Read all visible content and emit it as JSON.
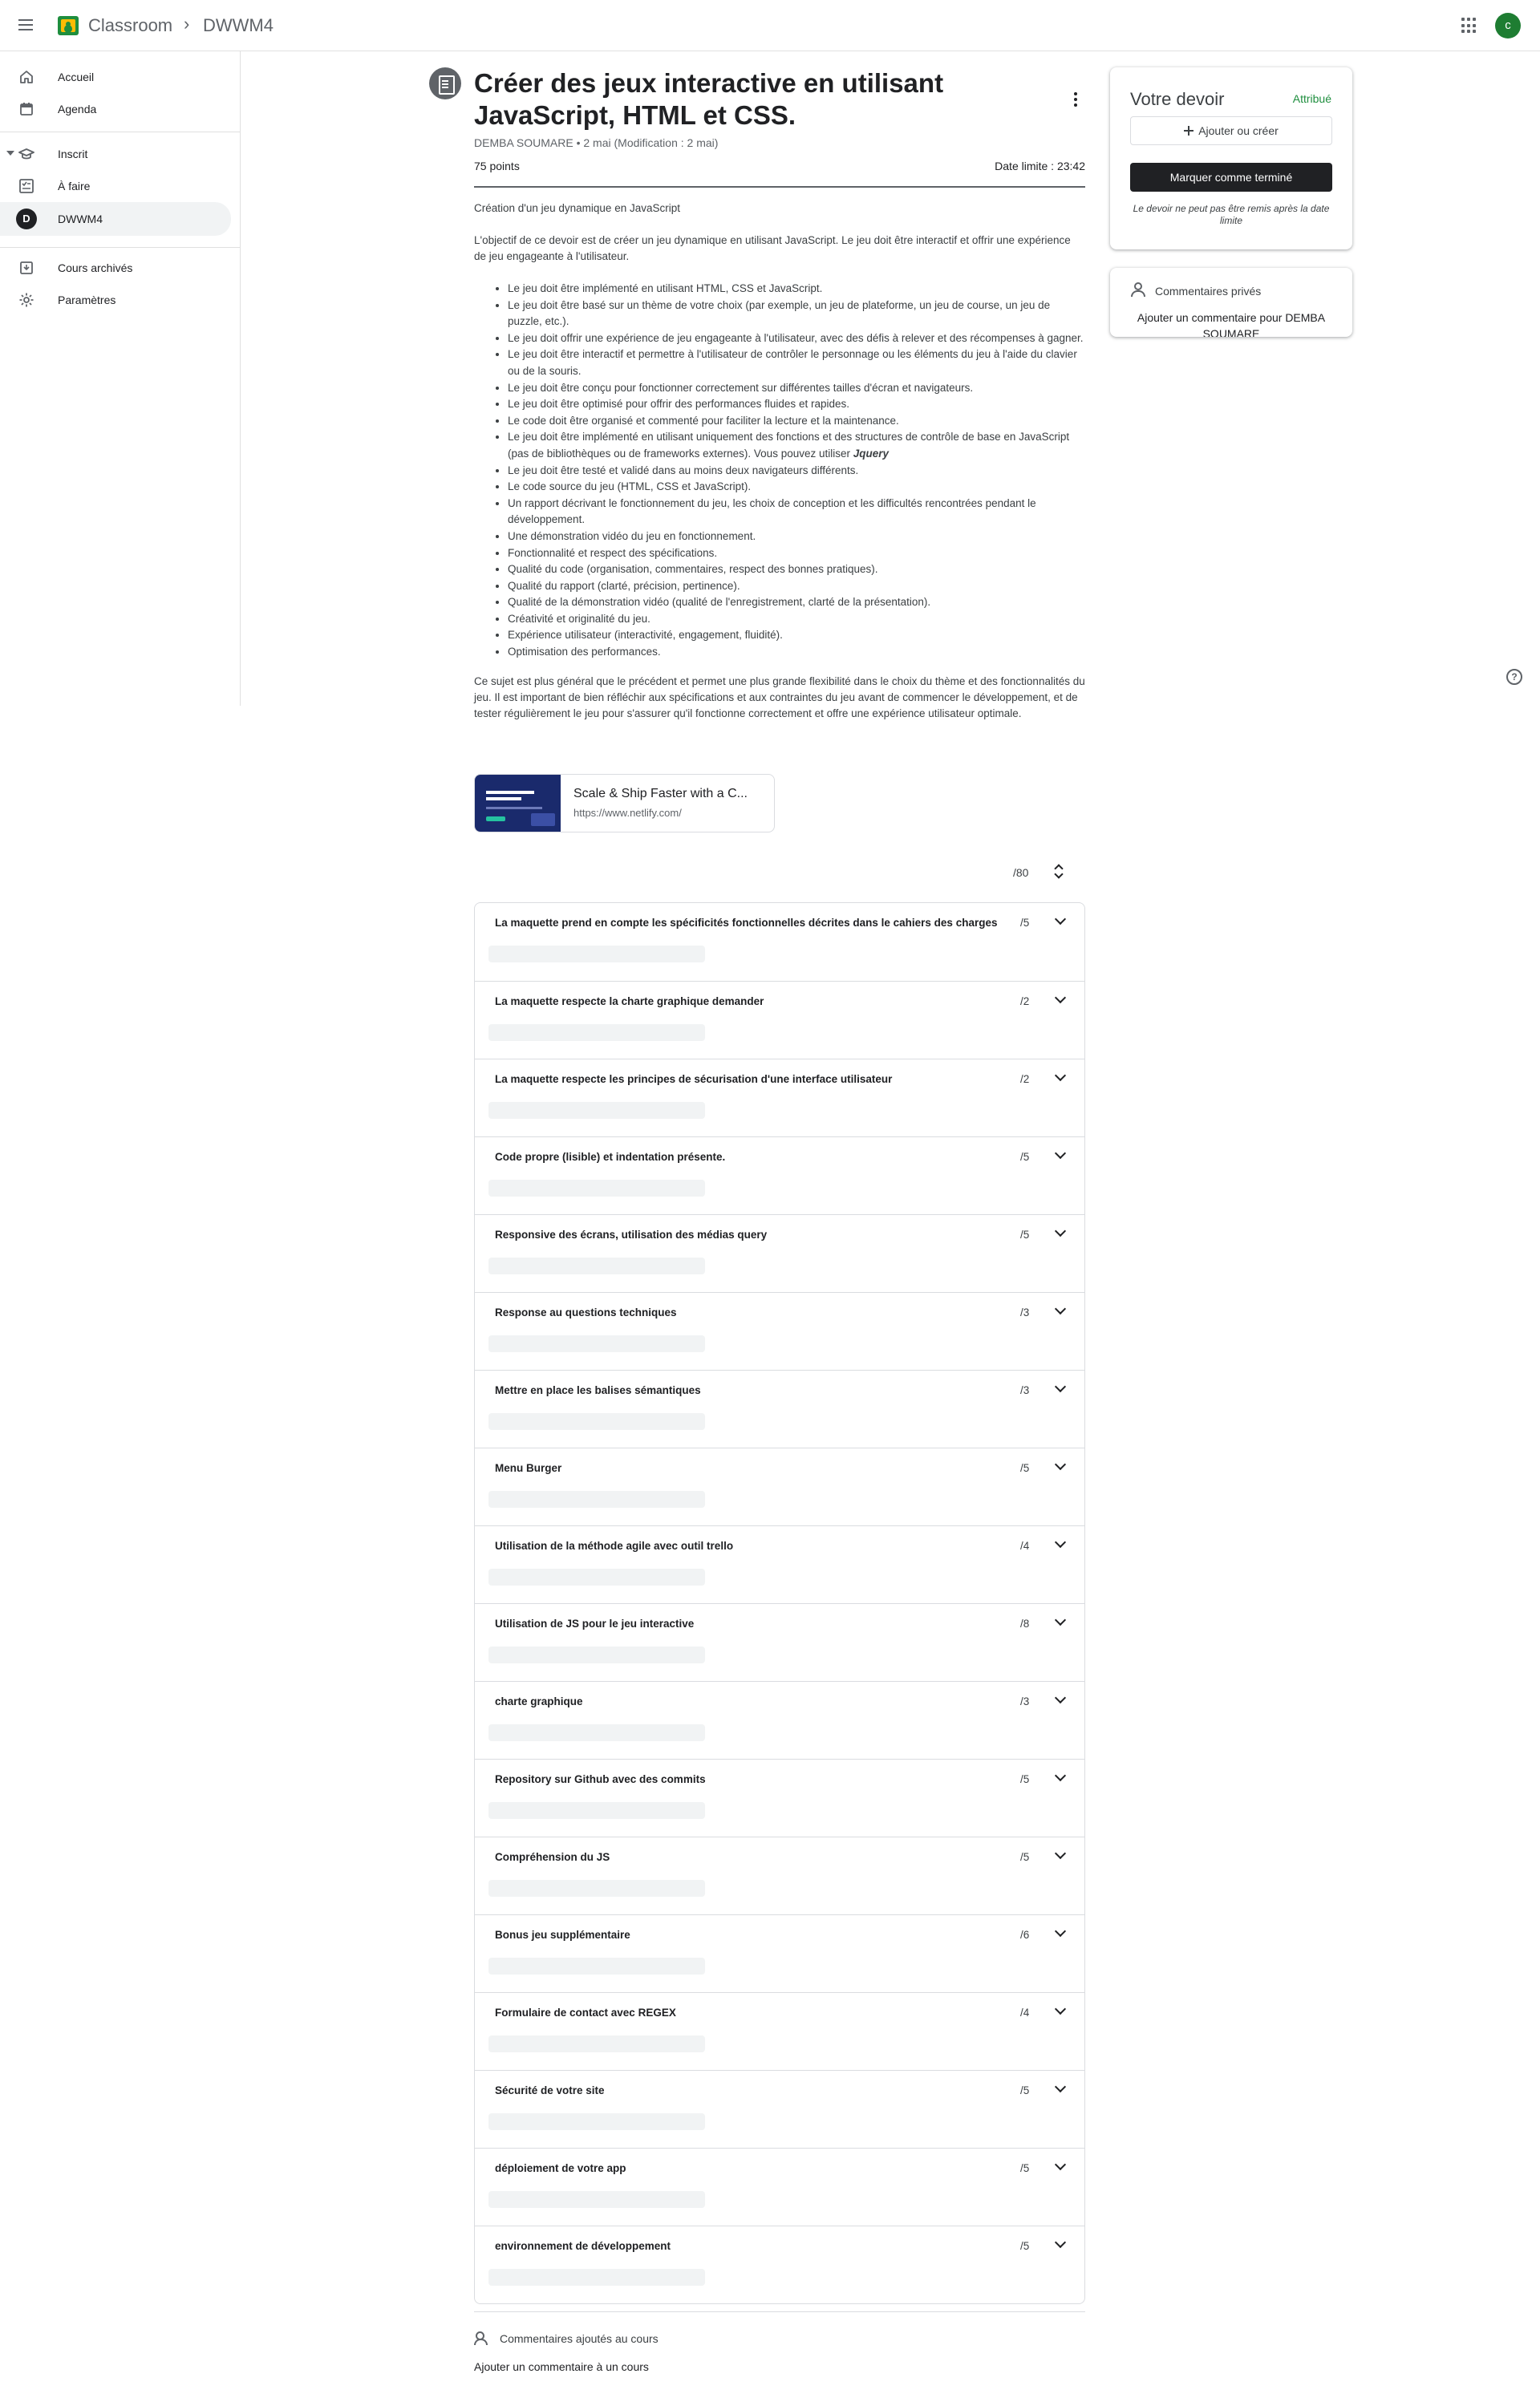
{
  "topbar": {
    "brand": "Classroom",
    "separator": "›",
    "breadcrumb": "DWWM4",
    "account_initial": "c"
  },
  "sidebar": {
    "items": [
      {
        "label": "Accueil",
        "icon": "home-icon"
      },
      {
        "label": "Agenda",
        "icon": "calendar-icon"
      },
      {
        "label": "Inscrit",
        "icon": "graduation-cap-icon"
      },
      {
        "label": "À faire",
        "icon": "todo-list-icon"
      },
      {
        "label": "DWWM4",
        "icon": "class-avatar",
        "initial": "D"
      },
      {
        "label": "Cours archivés",
        "icon": "archive-icon"
      },
      {
        "label": "Paramètres",
        "icon": "gear-icon"
      }
    ]
  },
  "assignment": {
    "title": "Créer des jeux interactive en utilisant JavaScript, HTML et CSS.",
    "meta": "DEMBA SOUMARE • 2 mai (Modification : 2 mai)",
    "points": "75 points",
    "deadline": "Date limite : 23:42",
    "intro": "Création d'un jeu dynamique en JavaScript",
    "objective": "L'objectif de ce devoir est de créer un jeu dynamique en utilisant JavaScript. Le jeu doit être interactif et offrir une expérience de jeu engageante à l'utilisateur.",
    "requirements": [
      "Le jeu doit être implémenté en utilisant HTML, CSS et JavaScript.",
      "Le jeu doit être basé sur un thème de votre choix (par exemple, un jeu de plateforme, un jeu de course, un jeu de puzzle, etc.).",
      "Le jeu doit offrir une expérience de jeu engageante à l'utilisateur, avec des défis à relever et des récompenses à gagner.",
      "Le jeu doit être interactif et permettre à l'utilisateur de contrôler le personnage ou les éléments du jeu à l'aide du clavier ou de la souris.",
      "Le jeu doit être conçu pour fonctionner correctement sur différentes tailles d'écran et navigateurs.",
      "Le jeu doit être optimisé pour offrir des performances fluides et rapides.",
      "Le code doit être organisé et commenté pour faciliter la lecture et la maintenance."
    ],
    "requirement_jquery_prefix": "Le jeu doit être implémenté en utilisant uniquement des fonctions et des structures de contrôle de base en JavaScript (pas de bibliothèques ou de frameworks externes). Vous pouvez utiliser ",
    "requirement_jquery_emphasis": "Jquery",
    "requirements_after": [
      "Le jeu doit être testé et validé dans au moins deux navigateurs différents.",
      "Le code source du jeu (HTML, CSS et JavaScript).",
      "Un rapport décrivant le fonctionnement du jeu, les choix de conception et les difficultés rencontrées pendant le développement.",
      "Une démonstration vidéo du jeu en fonctionnement.",
      "Fonctionnalité et respect des spécifications.",
      "Qualité du code (organisation, commentaires, respect des bonnes pratiques).",
      "Qualité du rapport (clarté, précision, pertinence).",
      "Qualité de la démonstration vidéo (qualité de l'enregistrement, clarté de la présentation).",
      "Créativité et originalité du jeu.",
      "Expérience utilisateur (interactivité, engagement, fluidité).",
      "Optimisation des performances."
    ],
    "conclusion": "Ce sujet est plus général que le précédent et permet une plus grande flexibilité dans le choix du thème et des fonctionnalités du jeu. Il est important de bien réfléchir aux spécifications et aux contraintes du jeu avant de commencer le développement, et de tester régulièrement le jeu pour s'assurer qu'il fonctionne correctement et offre une expérience utilisateur optimale.",
    "attachment": {
      "title": "Scale & Ship Faster with a C...",
      "url": "https://www.netlify.com/"
    }
  },
  "rubric": {
    "total": "/80",
    "criteria": [
      {
        "label": "La maquette prend en compte les spécificités fonctionnelles décrites dans le cahiers des charges",
        "score": "/5"
      },
      {
        "label": "La maquette respecte la charte graphique demander",
        "score": "/2"
      },
      {
        "label": "La maquette respecte les principes de sécurisation d'une interface utilisateur",
        "score": "/2"
      },
      {
        "label": "Code propre (lisible) et indentation présente.",
        "score": "/5"
      },
      {
        "label": "Responsive des écrans, utilisation des médias query",
        "score": "/5"
      },
      {
        "label": "Response au questions techniques",
        "score": "/3"
      },
      {
        "label": "Mettre en place les balises sémantiques",
        "score": "/3"
      },
      {
        "label": "Menu Burger",
        "score": "/5"
      },
      {
        "label": "Utilisation de la méthode agile avec outil trello",
        "score": "/4"
      },
      {
        "label": "Utilisation de JS pour le jeu interactive",
        "score": "/8"
      },
      {
        "label": "charte graphique",
        "score": "/3"
      },
      {
        "label": "Repository sur Github avec des commits",
        "score": "/5"
      },
      {
        "label": "Compréhension du JS",
        "score": "/5"
      },
      {
        "label": "Bonus jeu supplémentaire",
        "score": "/6"
      },
      {
        "label": "Formulaire de contact avec REGEX",
        "score": "/4"
      },
      {
        "label": "Sécurité de votre site",
        "score": "/5"
      },
      {
        "label": "déploiement de votre app",
        "score": "/5"
      },
      {
        "label": "environnement de développement",
        "score": "/5"
      }
    ]
  },
  "class_comments": {
    "title": "Commentaires ajoutés au cours",
    "add_label": "Ajouter un commentaire à un cours"
  },
  "your_work": {
    "title": "Votre devoir",
    "status": "Attribué",
    "add_label": "Ajouter ou créer",
    "done_label": "Marquer comme terminé",
    "late_note": "Le devoir ne peut pas être remis après la date limite"
  },
  "private_comments": {
    "title": "Commentaires privés",
    "add_label": "Ajouter un commentaire pour DEMBA SOUMARE"
  },
  "colors": {
    "accent_green": "#1e8e3e",
    "dark_button": "#202124",
    "text_primary": "#202124",
    "text_secondary": "#5f6368"
  }
}
